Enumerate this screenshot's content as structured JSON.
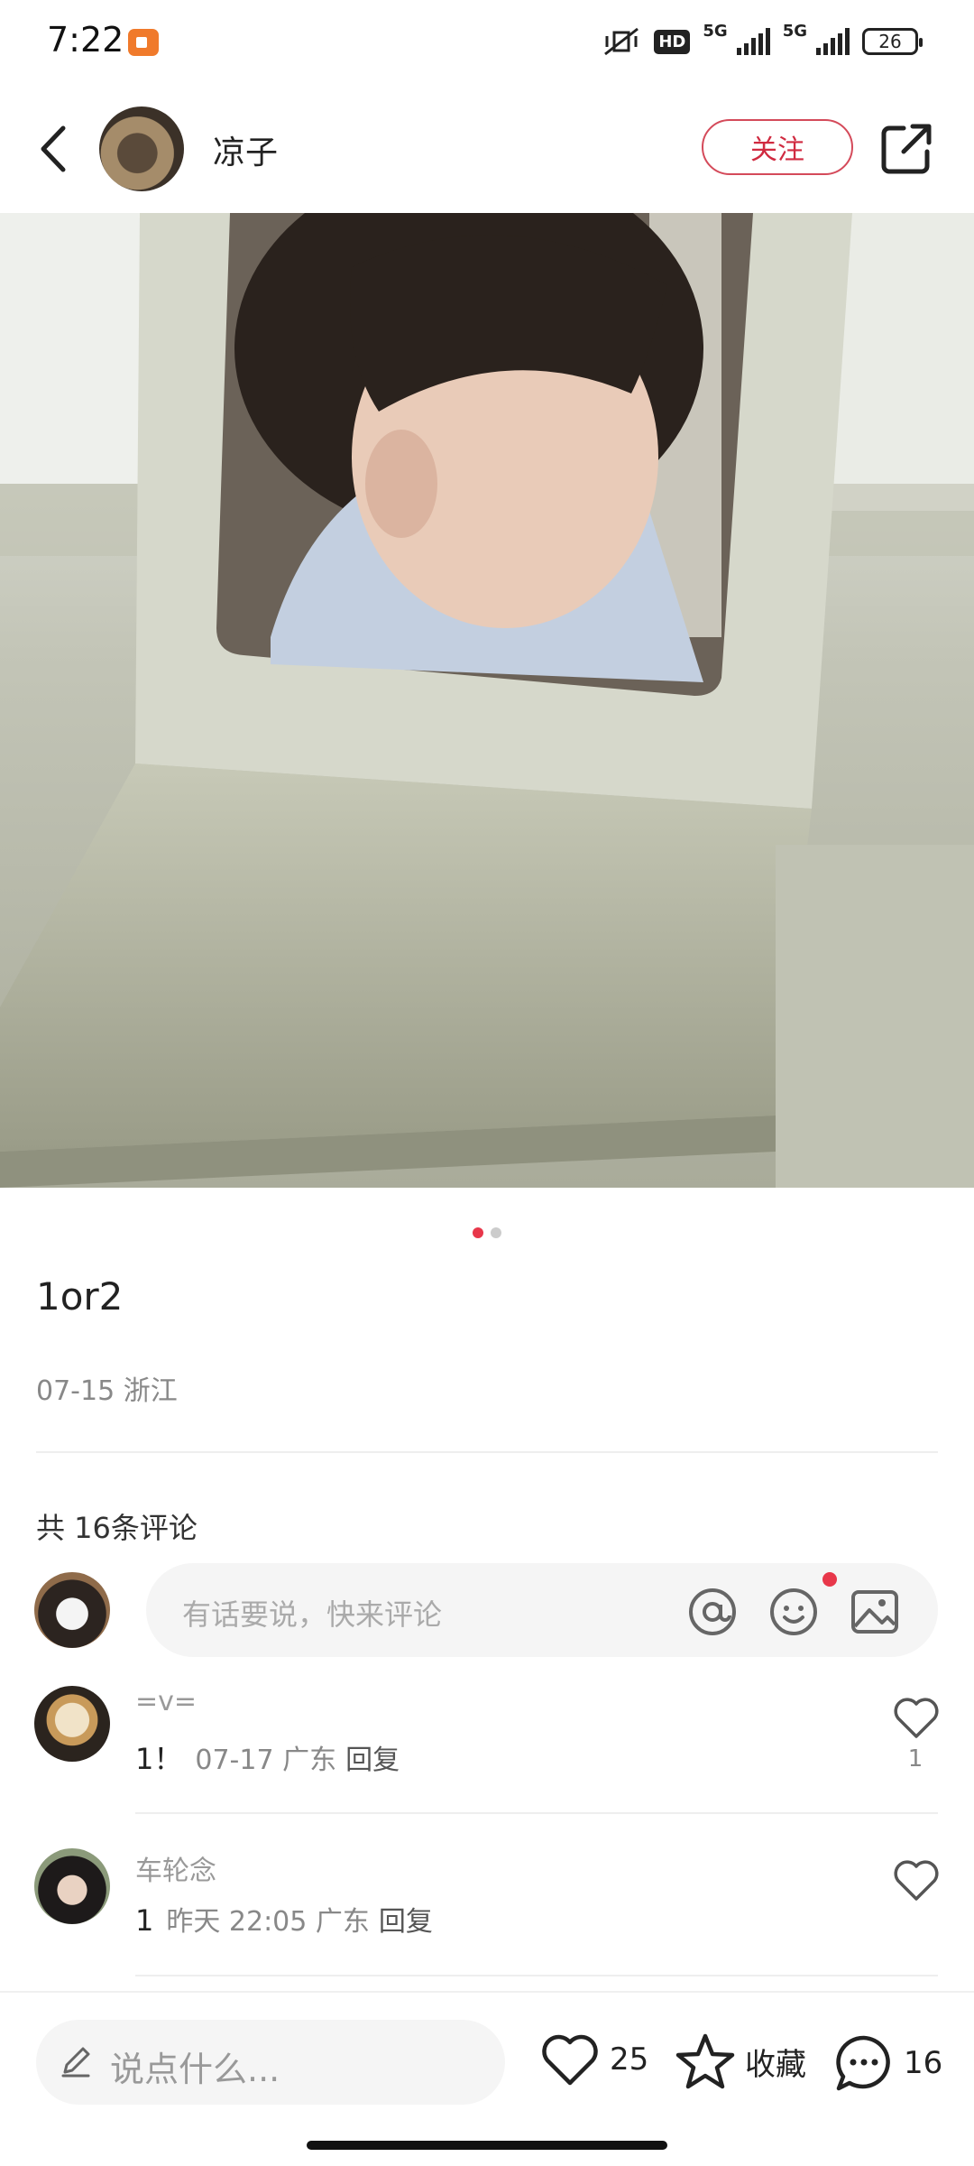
{
  "status_bar": {
    "time": "7:22",
    "network_1": "5G",
    "network_2": "5G",
    "hd_label": "HD",
    "battery": "26"
  },
  "header": {
    "author_name": "凉子",
    "follow_label": "关注"
  },
  "carousel": {
    "total_pages": 2,
    "current_page": 1
  },
  "post": {
    "title": "1or2",
    "meta": "07-15 浙江"
  },
  "comments_section": {
    "count_label": "共 16条评论",
    "input_placeholder": "有话要说，快来评论",
    "items": [
      {
        "name": "=v=",
        "text": "1！",
        "meta": "07-17 广东",
        "reply_label": "回复",
        "likes": "1"
      },
      {
        "name": "车轮念",
        "text": "1",
        "meta": "昨天 22:05 广东",
        "reply_label": "回复",
        "likes": ""
      }
    ]
  },
  "bottom_bar": {
    "say_placeholder": "说点什么...",
    "like_count": "25",
    "collect_label": "收藏",
    "comment_count": "16"
  },
  "colors": {
    "accent": "#e8374a",
    "follow_border": "#d44a5a"
  }
}
